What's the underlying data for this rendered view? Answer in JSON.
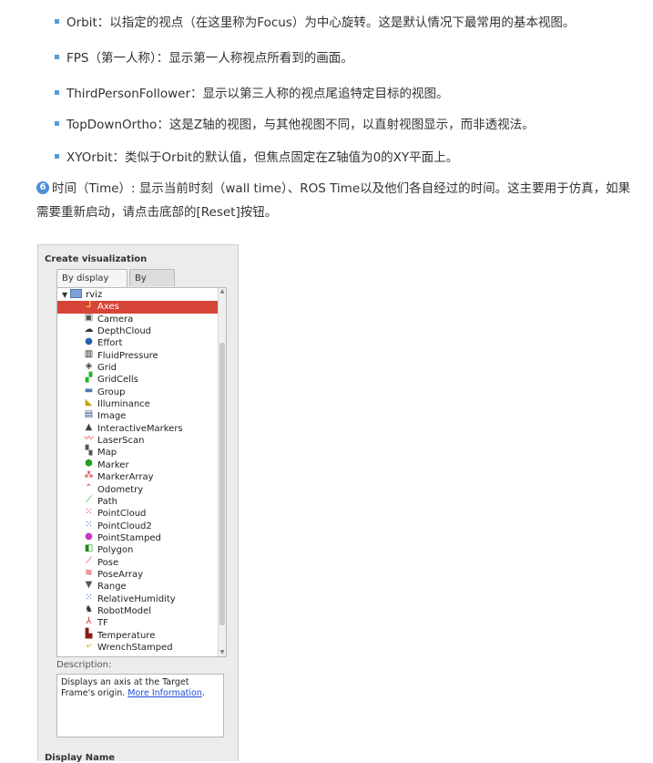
{
  "doc": {
    "bullets": [
      "Orbit：以指定的视点（在这里称为Focus）为中心旋转。这是默认情况下最常用的基本视图。",
      "FPS（第一人称）：显示第一人称视点所看到的画面。",
      "ThirdPersonFollower：显示以第三人称的视点尾追特定目标的视图。",
      "TopDownOrtho：这是Z轴的视图，与其他视图不同，以直射视图显示，而非透视法。",
      "XYOrbit：类似于Orbit的默认值，但焦点固定在Z轴值为0的XY平面上。"
    ],
    "note_number": "6",
    "note_text": "时间（Time）: 显示当前时刻（wall time）、ROS Time以及他们各自经过的时间。这主要用于仿真，如果需要重新启动，请点击底部的[Reset]按钮。"
  },
  "panel": {
    "title": "Create visualization",
    "tabs": [
      "By display type",
      "By topic"
    ],
    "root_label": "rviz",
    "items": [
      {
        "label": "Axes",
        "icon": "axes-icon",
        "selected": true
      },
      {
        "label": "Camera",
        "icon": "camera-icon"
      },
      {
        "label": "DepthCloud",
        "icon": "depthcloud-icon"
      },
      {
        "label": "Effort",
        "icon": "effort-icon"
      },
      {
        "label": "FluidPressure",
        "icon": "fluidpressure-icon"
      },
      {
        "label": "Grid",
        "icon": "grid-icon"
      },
      {
        "label": "GridCells",
        "icon": "gridcells-icon"
      },
      {
        "label": "Group",
        "icon": "folder-icon"
      },
      {
        "label": "Illuminance",
        "icon": "illuminance-icon"
      },
      {
        "label": "Image",
        "icon": "image-icon"
      },
      {
        "label": "InteractiveMarkers",
        "icon": "interactive-markers-icon"
      },
      {
        "label": "LaserScan",
        "icon": "laserscan-icon"
      },
      {
        "label": "Map",
        "icon": "map-icon"
      },
      {
        "label": "Marker",
        "icon": "marker-icon"
      },
      {
        "label": "MarkerArray",
        "icon": "markerarray-icon"
      },
      {
        "label": "Odometry",
        "icon": "odometry-icon"
      },
      {
        "label": "Path",
        "icon": "path-icon"
      },
      {
        "label": "PointCloud",
        "icon": "pointcloud-icon"
      },
      {
        "label": "PointCloud2",
        "icon": "pointcloud2-icon"
      },
      {
        "label": "PointStamped",
        "icon": "pointstamped-icon"
      },
      {
        "label": "Polygon",
        "icon": "polygon-icon"
      },
      {
        "label": "Pose",
        "icon": "pose-icon"
      },
      {
        "label": "PoseArray",
        "icon": "posearray-icon"
      },
      {
        "label": "Range",
        "icon": "range-icon"
      },
      {
        "label": "RelativeHumidity",
        "icon": "relativehumidity-icon"
      },
      {
        "label": "RobotModel",
        "icon": "robotmodel-icon"
      },
      {
        "label": "TF",
        "icon": "tf-icon"
      },
      {
        "label": "Temperature",
        "icon": "temperature-icon"
      },
      {
        "label": "WrenchStamped",
        "icon": "wrenchstamped-icon"
      }
    ],
    "description_label": "Description:",
    "description_text": "Displays an axis at the Target Frame's origin. ",
    "description_link": "More Information",
    "description_end": ".",
    "display_name_label": "Display Name",
    "colors": {
      "selection": "#d64537",
      "link": "#1a4fd6",
      "bullet": "#5a9ad8"
    }
  }
}
